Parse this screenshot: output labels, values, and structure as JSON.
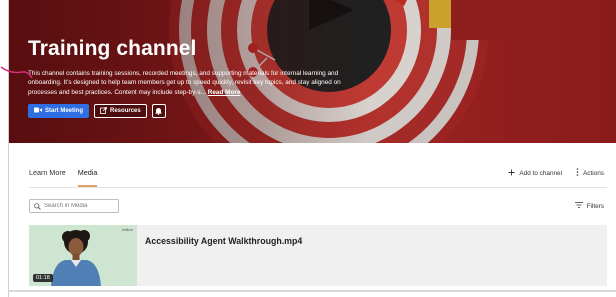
{
  "hero": {
    "title": "Training channel",
    "description": "This channel contains training sessions, recorded meetings, and supporting materials for internal learning and onboarding. It’s designed to help team members get up to speed quickly, revisit key topics, and stay aligned on processes and best practices. Content may include step-by-s...",
    "read_more": "Read More",
    "buttons": {
      "start_meeting": "Start Meeting",
      "resources": "Resources"
    }
  },
  "tabs": [
    {
      "label": "Learn More",
      "active": false
    },
    {
      "label": "Media",
      "active": true
    }
  ],
  "actions": {
    "add_to_channel": "Add to channel",
    "actions": "Actions"
  },
  "search": {
    "placeholder": "Search in Media"
  },
  "filters_label": "Filters",
  "media": [
    {
      "title": "Accessibility Agent Walkthrough.mp4",
      "duration": "01:18",
      "brand": "brillium"
    }
  ],
  "colors": {
    "accent_tab": "#e0a06a",
    "primary_button": "#2f6fe4",
    "hero_red": "#8c1c1d"
  },
  "icons": [
    "video-camera-icon",
    "external-link-icon",
    "bell-icon",
    "plus-icon",
    "more-vertical-icon",
    "search-icon",
    "filter-icon"
  ]
}
